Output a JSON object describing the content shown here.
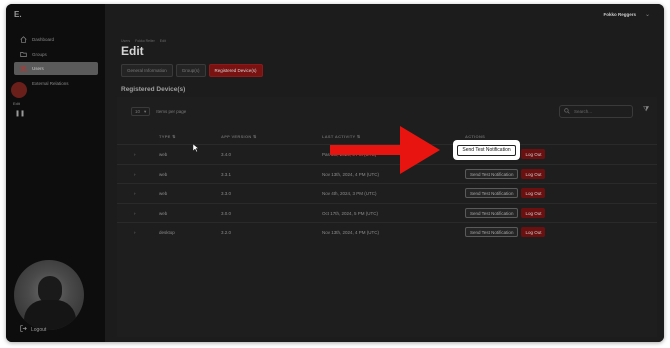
{
  "app": {
    "logo": "E."
  },
  "sidebar": {
    "items": [
      {
        "label": "Dashboard",
        "icon": "home-icon"
      },
      {
        "label": "Groups",
        "icon": "folder-icon"
      },
      {
        "label": "Users",
        "icon": "users-icon",
        "active": true
      },
      {
        "label": "External Relations",
        "icon": "link-icon"
      }
    ],
    "collapse_label": "Edit",
    "logout_label": "Logout"
  },
  "header": {
    "user_name": "Fokko Reggers",
    "menu_icon": "chevron-down-icon"
  },
  "breadcrumb": [
    "Users",
    "Fokko Reller",
    "Edit"
  ],
  "page_title": "Edit",
  "tabs": [
    {
      "label": "General Information",
      "active": false
    },
    {
      "label": "Group(s)",
      "active": false
    },
    {
      "label": "Registered Device(s)",
      "active": true
    }
  ],
  "section_title": "Registered Device(s)",
  "table": {
    "per_page_value": "10",
    "per_page_label": "Items per page",
    "search_placeholder": "Search...",
    "columns": [
      "TYPE",
      "APP VERSION",
      "LAST ACTIVITY",
      "ACTIONS"
    ],
    "rows": [
      {
        "type": "web",
        "version": "3.4.0",
        "last_activity": "Pas 5th, 2024, 4 PM (UTC)"
      },
      {
        "type": "web",
        "version": "3.3.1",
        "last_activity": "Nov 13th, 2024, 4 PM (UTC)"
      },
      {
        "type": "web",
        "version": "3.3.0",
        "last_activity": "Nov 4th, 2024, 3 PM (UTC)"
      },
      {
        "type": "web",
        "version": "3.0.0",
        "last_activity": "Oct 17th, 2024, 5 PM (UTC)"
      },
      {
        "type": "desktop",
        "version": "3.2.0",
        "last_activity": "Nov 13th, 2024, 4 PM (UTC)"
      }
    ],
    "notify_label": "Send Test Notification",
    "logout_label": "Log Out"
  },
  "highlight": {
    "label": "Send Test Notification"
  },
  "colors": {
    "accent": "#7a1212",
    "arrow": "#e8140f",
    "sidebar_bg": "#0d0d0d",
    "main_bg": "#1c1c1c"
  }
}
